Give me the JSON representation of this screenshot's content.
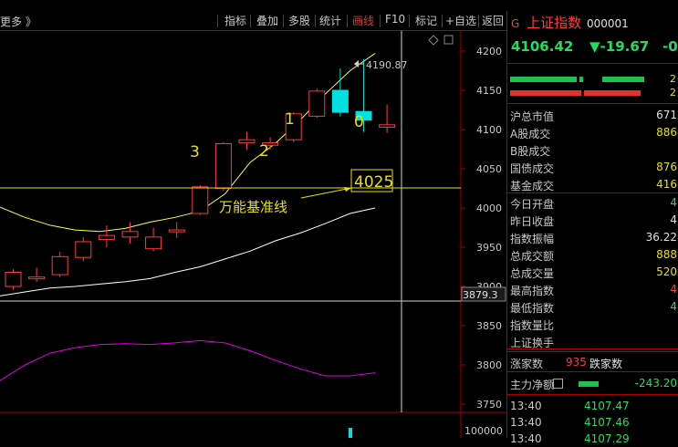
{
  "toolbar": {
    "more_label": "更多 》",
    "buttons": [
      "指标",
      "叠加",
      "多股",
      "统计",
      "画线",
      "F10",
      "标记",
      "+自选",
      "返回"
    ],
    "active": "画线"
  },
  "chart": {
    "price_ticks": [
      "4200",
      "4150",
      "4100",
      "4050",
      "4000",
      "3950",
      "3900",
      "3850",
      "3800",
      "3750"
    ],
    "crosshair_value": "3879.3",
    "high_label": "4190.87",
    "baseline_label": "4025",
    "baseline_note": "万能基准线",
    "wave_labels": [
      "3",
      "2",
      "1",
      "0"
    ],
    "volume_tick": "100000"
  },
  "colors": {
    "up": "#ff3b3b",
    "down": "#00e0e0",
    "ma5": "#ffff3a",
    "ma_white": "#ffffff",
    "ma_magenta": "#e000e0",
    "panel_border": "#a00000"
  },
  "quote": {
    "badge": "G",
    "name": "上证指数",
    "code": "000001",
    "price": "4106.42",
    "change": "▼-19.67",
    "change_pct": "-0",
    "bar_value_1": "2",
    "bar_value_2": "2"
  },
  "stats": [
    {
      "label": "沪总市值",
      "value": "671",
      "color": "white"
    },
    {
      "label": "A股成交",
      "value": "886",
      "color": "yellow"
    },
    {
      "label": "B股成交",
      "value": "",
      "color": "yellow"
    },
    {
      "label": "国债成交",
      "value": "876",
      "color": "yellow"
    },
    {
      "label": "基金成交",
      "value": "416",
      "color": "yellow"
    },
    {
      "label": "今日开盘",
      "value": "4",
      "color": "green"
    },
    {
      "label": "昨日收盘",
      "value": "4",
      "color": "white"
    },
    {
      "label": "指数振幅",
      "value": "36.22",
      "color": "white"
    },
    {
      "label": "总成交额",
      "value": "888",
      "color": "yellow"
    },
    {
      "label": "总成交量",
      "value": "520",
      "color": "yellow"
    },
    {
      "label": "最高指数",
      "value": "4",
      "color": "red"
    },
    {
      "label": "最低指数",
      "value": "4",
      "color": "green"
    },
    {
      "label": "指数量比",
      "value": "",
      "color": "white"
    },
    {
      "label": "上证换手",
      "value": "",
      "color": "white"
    }
  ],
  "breadth": {
    "up_label": "涨家数",
    "up_value": "935",
    "down_label": "跌家数"
  },
  "mainflow": {
    "label": "主力净额",
    "value": "-243.20"
  },
  "ticks": [
    {
      "time": "13:40",
      "price": "4107.47"
    },
    {
      "time": "13:40",
      "price": "4107.46"
    },
    {
      "time": "13:40",
      "price": "4107.29"
    }
  ],
  "candles": [
    {
      "o": 3900,
      "c": 3918,
      "h": 3922,
      "l": 3896,
      "up": true
    },
    {
      "o": 3912,
      "c": 3910,
      "h": 3924,
      "l": 3906,
      "up": true
    },
    {
      "o": 3915,
      "c": 3938,
      "h": 3944,
      "l": 3912,
      "up": true
    },
    {
      "o": 3937,
      "c": 3957,
      "h": 3963,
      "l": 3932,
      "up": true
    },
    {
      "o": 3960,
      "c": 3965,
      "h": 3978,
      "l": 3950,
      "up": true
    },
    {
      "o": 3963,
      "c": 3970,
      "h": 3982,
      "l": 3955,
      "up": true
    },
    {
      "o": 3948,
      "c": 3963,
      "h": 3975,
      "l": 3945,
      "up": true
    },
    {
      "o": 3970,
      "c": 3972,
      "h": 3982,
      "l": 3962,
      "up": true
    },
    {
      "o": 3993,
      "c": 4027,
      "h": 4029,
      "l": 3991,
      "up": true
    },
    {
      "o": 4025,
      "c": 4082,
      "h": 4084,
      "l": 4022,
      "up": true
    },
    {
      "o": 4083,
      "c": 4087,
      "h": 4097,
      "l": 4074,
      "up": true
    },
    {
      "o": 4080,
      "c": 4083,
      "h": 4090,
      "l": 4075,
      "up": true
    },
    {
      "o": 4087,
      "c": 4120,
      "h": 4122,
      "l": 4084,
      "up": true
    },
    {
      "o": 4117,
      "c": 4149,
      "h": 4152,
      "l": 4115,
      "up": true
    },
    {
      "o": 4150,
      "c": 4122,
      "h": 4178,
      "l": 4117,
      "up": false
    },
    {
      "o": 4123,
      "c": 4112,
      "h": 4190,
      "l": 4097,
      "up": false
    },
    {
      "o": 4103,
      "c": 4106,
      "h": 4132,
      "l": 4096,
      "up": true
    }
  ]
}
